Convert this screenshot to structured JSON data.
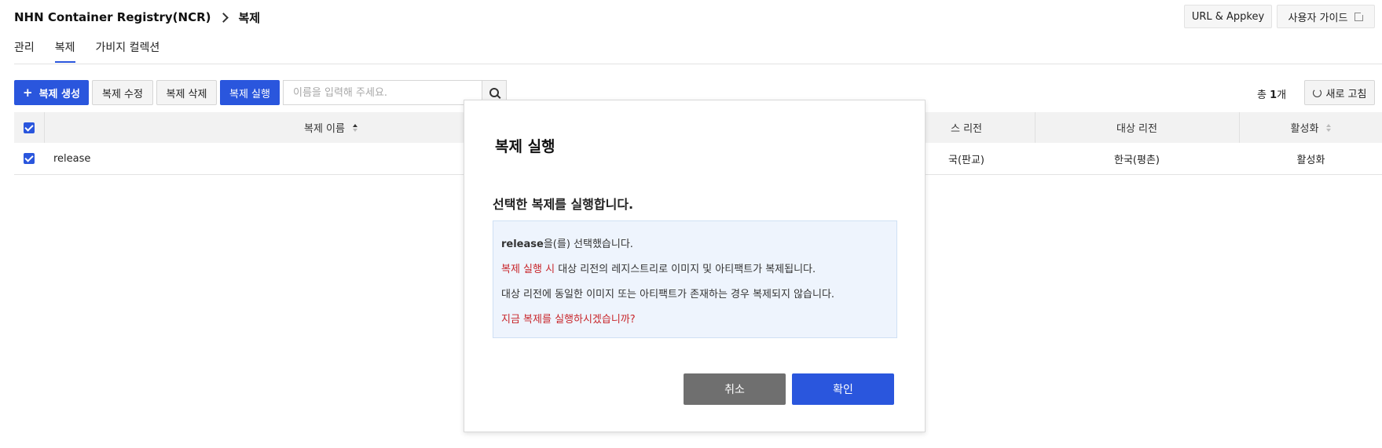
{
  "header": {
    "service": "NHN Container Registry(NCR)",
    "page": "복제",
    "url_appkey_label": "URL & Appkey",
    "guide_label": "사용자 가이드"
  },
  "tabs": [
    {
      "label": "관리",
      "active": false
    },
    {
      "label": "복제",
      "active": true
    },
    {
      "label": "가비지 컬렉션",
      "active": false
    }
  ],
  "toolbar": {
    "create_label": "복제 생성",
    "edit_label": "복제 수정",
    "delete_label": "복제 삭제",
    "run_label": "복제 실행",
    "search_placeholder": "이름을 입력해 주세요.",
    "total_prefix": "총 ",
    "total_count": "1",
    "total_suffix": "개",
    "refresh_label": "새로 고침"
  },
  "table": {
    "headers": {
      "name": "복제 이름",
      "source_region": "스 리전",
      "target_region": "대상 리전",
      "enabled": "활성화"
    },
    "rows": [
      {
        "name": "release",
        "source_region": "국(판교)",
        "target_region": "한국(평촌)",
        "enabled": "활성화",
        "checked": true
      }
    ]
  },
  "modal": {
    "title": "복제 실행",
    "subtitle": "선택한 복제를 실행합니다.",
    "line1_bold": "release",
    "line1_rest": "을(를) 선택했습니다.",
    "line2_red": "복제 실행 시",
    "line2_rest": " 대상 리전의 레지스트리로 이미지 및 아티팩트가 복제됩니다.",
    "line3": "대상 리전에 동일한 이미지 또는 아티팩트가 존재하는 경우 복제되지 않습니다.",
    "line4_red": "지금 복제를 실행하시겠습니까?",
    "cancel_label": "취소",
    "confirm_label": "확인"
  },
  "colors": {
    "primary": "#2a56dd",
    "danger_text": "#c8262b",
    "info_bg": "#eef4fd",
    "cancel_bg": "#6f6f6f"
  }
}
